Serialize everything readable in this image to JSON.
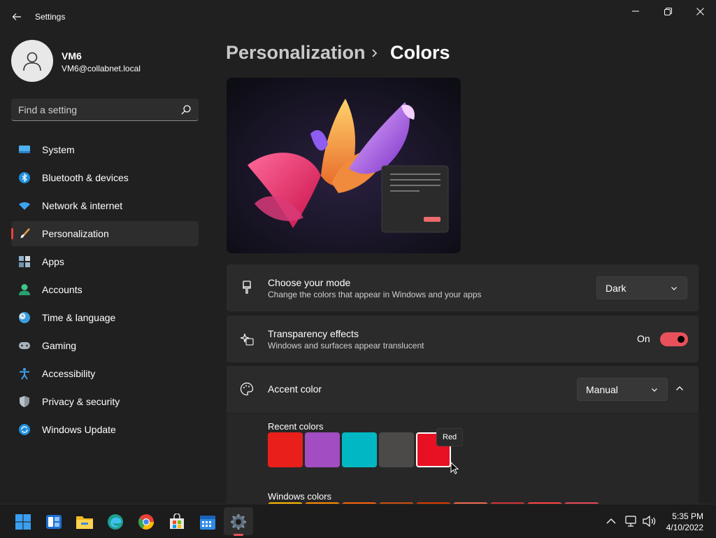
{
  "window": {
    "title": "Settings"
  },
  "profile": {
    "name": "VM6",
    "email": "VM6@collabnet.local"
  },
  "search": {
    "placeholder": "Find a setting"
  },
  "sidebar": {
    "items": [
      {
        "label": "System",
        "icon": "system-icon"
      },
      {
        "label": "Bluetooth & devices",
        "icon": "bluetooth-icon"
      },
      {
        "label": "Network & internet",
        "icon": "wifi-icon"
      },
      {
        "label": "Personalization",
        "icon": "brush-icon",
        "active": true
      },
      {
        "label": "Apps",
        "icon": "apps-icon"
      },
      {
        "label": "Accounts",
        "icon": "accounts-icon"
      },
      {
        "label": "Time & language",
        "icon": "clock-globe-icon"
      },
      {
        "label": "Gaming",
        "icon": "gamepad-icon"
      },
      {
        "label": "Accessibility",
        "icon": "accessibility-icon"
      },
      {
        "label": "Privacy & security",
        "icon": "shield-icon"
      },
      {
        "label": "Windows Update",
        "icon": "update-icon"
      }
    ]
  },
  "breadcrumb": {
    "parent": "Personalization",
    "current": "Colors"
  },
  "mode_card": {
    "title": "Choose your mode",
    "subtitle": "Change the colors that appear in Windows and your apps",
    "value": "Dark"
  },
  "transparency_card": {
    "title": "Transparency effects",
    "subtitle": "Windows and surfaces appear translucent",
    "state_label": "On",
    "state": true
  },
  "accent_card": {
    "title": "Accent color",
    "value": "Manual",
    "recent_label": "Recent colors",
    "windows_label": "Windows colors",
    "tooltip": "Red",
    "recent_colors": [
      "#e81f1a",
      "#a24dc2",
      "#00b7c3",
      "#4c4a48",
      "#e81123"
    ],
    "windows_colors": [
      "#ffb900",
      "#ff8c00",
      "#f7630c",
      "#ca5010",
      "#da3b01",
      "#ef6950",
      "#d13438",
      "#ff4343",
      "#e74856"
    ]
  },
  "taskbar": {
    "apps": [
      "start-icon",
      "widgets-icon",
      "file-explorer-icon",
      "edge-icon",
      "chrome-icon",
      "store-icon",
      "calendar-icon",
      "settings-gear-icon"
    ],
    "time": "5:35 PM",
    "date": "4/10/2022"
  },
  "colors": {
    "accent": "#e8515a",
    "background": "#202020",
    "card": "#2b2b2b"
  }
}
